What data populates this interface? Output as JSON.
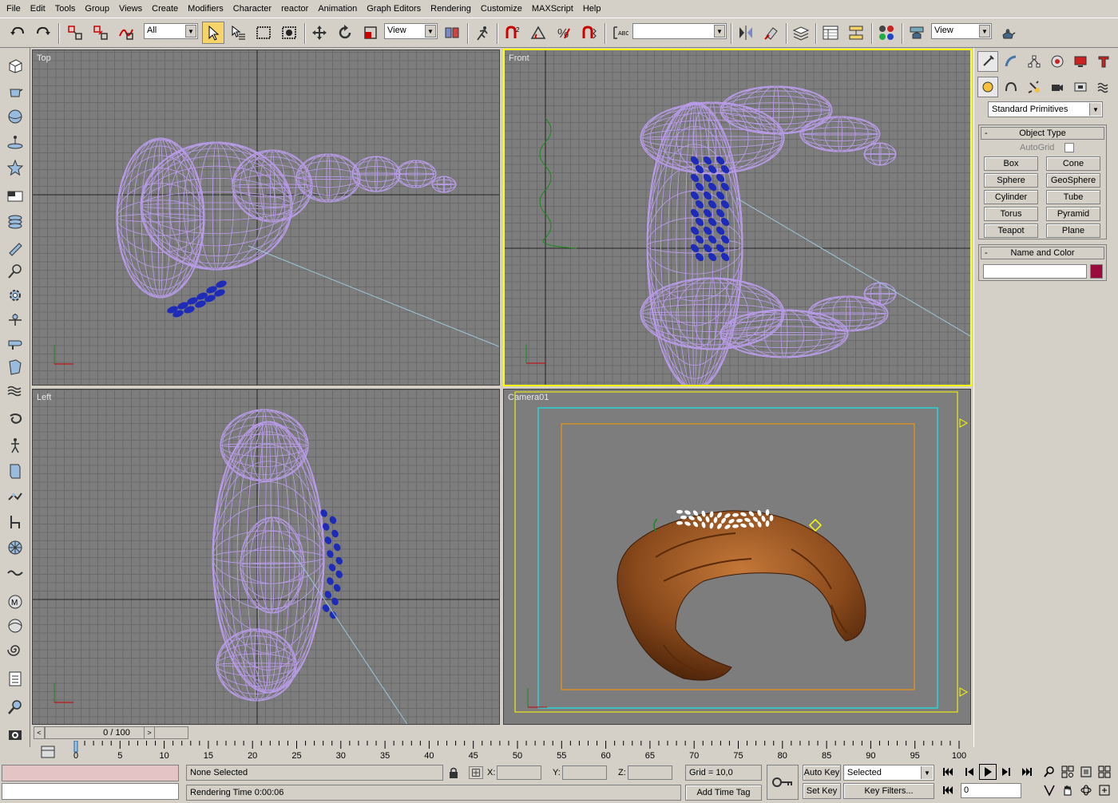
{
  "menu": [
    "File",
    "Edit",
    "Tools",
    "Group",
    "Views",
    "Create",
    "Modifiers",
    "Character",
    "reactor",
    "Animation",
    "Graph Editors",
    "Rendering",
    "Customize",
    "MAXScript",
    "Help"
  ],
  "toolbar": {
    "selection_filter": "All",
    "ref_coord_1": "View",
    "named_selection": "",
    "ref_coord_2": "View"
  },
  "viewports": {
    "top": "Top",
    "front": "Front",
    "left": "Left",
    "camera": "Camera01"
  },
  "command_panel": {
    "category": "Standard Primitives",
    "object_type": {
      "title": "Object Type",
      "autogrid": "AutoGrid",
      "buttons": [
        "Box",
        "Cone",
        "Sphere",
        "GeoSphere",
        "Cylinder",
        "Tube",
        "Torus",
        "Pyramid",
        "Teapot",
        "Plane"
      ]
    },
    "name_and_color": {
      "title": "Name and Color",
      "name_value": "",
      "color": "#9a0a3a"
    }
  },
  "timeslider": {
    "frame": "0 / 100",
    "prev": "<",
    "next": ">"
  },
  "trackbar": {
    "ticks": [
      "0",
      "5",
      "10",
      "15",
      "20",
      "25",
      "30",
      "35",
      "40",
      "45",
      "50",
      "55",
      "60",
      "65",
      "70",
      "75",
      "80",
      "85",
      "90",
      "95",
      "100"
    ]
  },
  "status": {
    "selection": "None Selected",
    "prompt": "Rendering Time  0:00:06",
    "x_label": "X:",
    "y_label": "Y:",
    "z_label": "Z:",
    "grid": "Grid = 10,0",
    "add_time_tag": "Add Time Tag",
    "auto_key": "Auto Key",
    "set_key": "Set Key",
    "key_mode": "Selected",
    "key_filters": "Key Filters...",
    "current_frame": "0"
  },
  "colors": {
    "wire": "#b89ce8",
    "seeds": "#1e2bb8",
    "viewport_bg": "#7d7d7d",
    "grid": "#6a6a6a",
    "active_border": "#ffff00",
    "safe_frame_outer": "#00ffff",
    "safe_frame_inner": "#ff9900"
  }
}
